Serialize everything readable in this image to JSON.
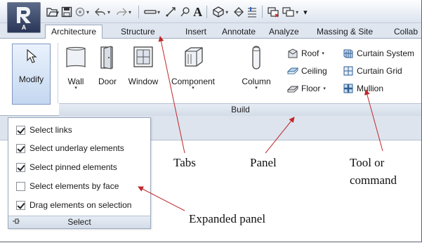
{
  "app_button": {
    "letter": "A"
  },
  "qat": {
    "icons": [
      "open-icon",
      "save-icon",
      "sync-icon",
      "undo-icon",
      "redo-icon",
      "measure-icon",
      "dimension-icon",
      "tag-icon",
      "text-icon",
      "3d-view-icon",
      "section-icon",
      "thin-lines-icon",
      "close-windows-icon",
      "switch-windows-icon",
      "customize-icon"
    ],
    "text_glyph": "A"
  },
  "tabs": [
    {
      "label": "Architecture",
      "active": true
    },
    {
      "label": "Structure"
    },
    {
      "label": "Insert"
    },
    {
      "label": "Annotate"
    },
    {
      "label": "Analyze"
    },
    {
      "label": "Massing & Site"
    },
    {
      "label": "Collab"
    }
  ],
  "ribbon": {
    "modify": {
      "label": "Modify"
    },
    "tools": [
      {
        "label": "Wall",
        "has_dropdown": true
      },
      {
        "label": "Door"
      },
      {
        "label": "Window"
      },
      {
        "label": "Component",
        "has_dropdown": true
      },
      {
        "label": "Column",
        "has_dropdown": true
      }
    ],
    "small_tools": [
      {
        "label": "Roof",
        "has_dropdown": true
      },
      {
        "label": "Ceiling"
      },
      {
        "label": "Floor",
        "has_dropdown": true
      },
      {
        "label": "Curtain System"
      },
      {
        "label": "Curtain Grid"
      },
      {
        "label": "Mullion"
      }
    ],
    "panel_title": "Build"
  },
  "expanded_panel": {
    "items": [
      {
        "label": "Select links",
        "checked": true
      },
      {
        "label": "Select underlay elements",
        "checked": true
      },
      {
        "label": "Select pinned elements",
        "checked": true
      },
      {
        "label": "Select elements by face",
        "checked": false
      },
      {
        "label": "Drag elements on selection",
        "checked": true
      }
    ],
    "title": "Select"
  },
  "annotations": {
    "tabs": "Tabs",
    "panel": "Panel",
    "tool_line1": "Tool or",
    "tool_line2": "command",
    "expanded": "Expanded  panel"
  },
  "colors": {
    "annotation_arrow": "#c0282a",
    "app_button": "#2a3658",
    "ribbon_bg": "#dfe6f0"
  }
}
